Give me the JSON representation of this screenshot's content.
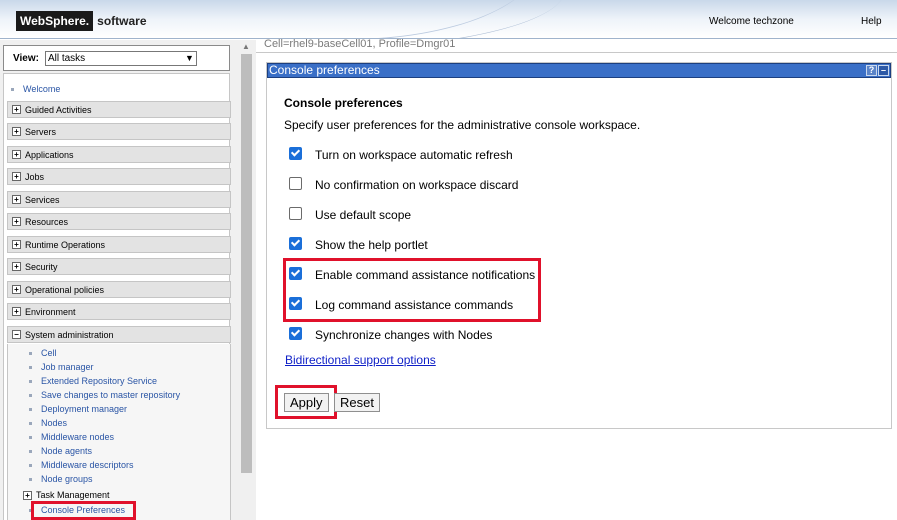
{
  "header": {
    "brand": "WebSphere.",
    "brand_suffix": "software",
    "welcome": "Welcome techzone",
    "help": "Help"
  },
  "nav": {
    "view_label": "View:",
    "view_value": "All tasks",
    "welcome_link": "Welcome",
    "categories": [
      {
        "label": "Guided Activities",
        "expanded": false
      },
      {
        "label": "Servers",
        "expanded": false
      },
      {
        "label": "Applications",
        "expanded": false
      },
      {
        "label": "Jobs",
        "expanded": false
      },
      {
        "label": "Services",
        "expanded": false
      },
      {
        "label": "Resources",
        "expanded": false
      },
      {
        "label": "Runtime Operations",
        "expanded": false
      },
      {
        "label": "Security",
        "expanded": false
      },
      {
        "label": "Operational policies",
        "expanded": false
      },
      {
        "label": "Environment",
        "expanded": false
      },
      {
        "label": "System administration",
        "expanded": true
      }
    ],
    "sysadmin_items": [
      "Cell",
      "Job manager",
      "Extended Repository Service",
      "Save changes to master repository",
      "Deployment manager",
      "Nodes",
      "Middleware nodes",
      "Node agents",
      "Middleware descriptors",
      "Node groups"
    ],
    "task_management": "Task Management",
    "console_preferences": "Console Preferences"
  },
  "main": {
    "breadcrumb": "Cell=rhel9-baseCell01, Profile=Dmgr01",
    "panel_title": "Console preferences",
    "help_icon": "?",
    "min_icon": "–",
    "heading": "Console preferences",
    "description": "Specify user preferences for the administrative console workspace.",
    "options": [
      {
        "label": "Turn on workspace automatic refresh",
        "checked": true
      },
      {
        "label": "No confirmation on workspace discard",
        "checked": false
      },
      {
        "label": "Use default scope",
        "checked": false
      },
      {
        "label": "Show the help portlet",
        "checked": true
      },
      {
        "label": "Enable command assistance notifications",
        "checked": true
      },
      {
        "label": "Log command assistance commands",
        "checked": true
      },
      {
        "label": "Synchronize changes with Nodes",
        "checked": true
      }
    ],
    "bidi_link": "Bidirectional support options",
    "apply": "Apply",
    "reset": "Reset"
  },
  "colors": {
    "title_bar": "#3a6fc7",
    "highlight": "#e0112b",
    "link": "#2a55a5"
  }
}
